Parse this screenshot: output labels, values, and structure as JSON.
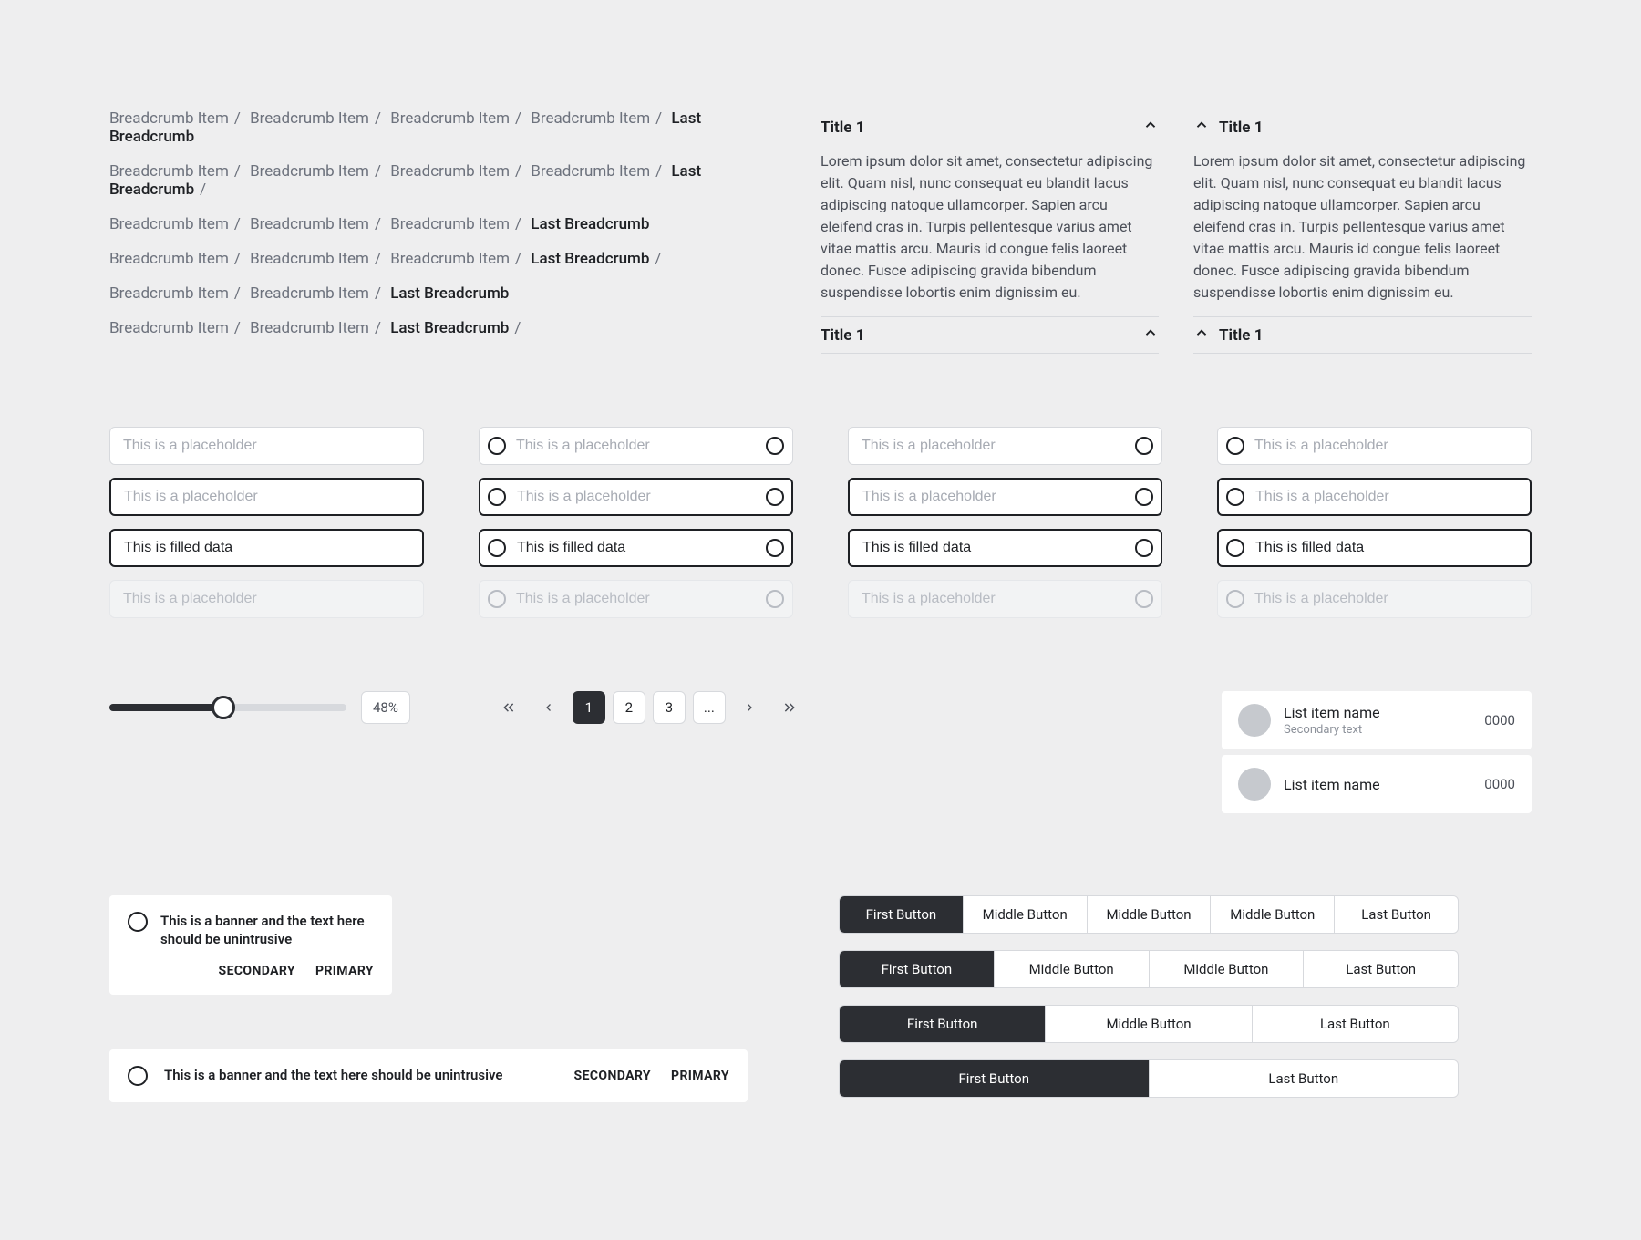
{
  "breadcrumbs": {
    "item": "Breadcrumb Item",
    "last": "Last Breadcrumb",
    "sep": "/"
  },
  "accordion": {
    "title": "Title 1",
    "body": "Lorem ipsum dolor sit amet, consectetur adipiscing elit. Quam nisl, nunc consequat eu blandit lacus adipiscing natoque ullamcorper. Sapien arcu eleifend cras in. Turpis pellentesque varius amet vitae mattis arcu. Mauris id congue felis laoreet donec. Fusce adipiscing gravida bibendum suspendisse lobortis enim dignissim eu."
  },
  "inputs": {
    "placeholder": "This is a placeholder",
    "filled": "This is filled data"
  },
  "slider": {
    "value_label": "48%"
  },
  "pagination": {
    "pages": [
      "1",
      "2",
      "3",
      "..."
    ]
  },
  "list": {
    "name": "List item name",
    "secondary": "Secondary text",
    "number": "0000"
  },
  "banners": {
    "text_multi": "This is a banner and the text here should be unintrusive",
    "text_single": "This is a banner and the text here should be unintrusive",
    "secondary": "SECONDARY",
    "primary": "PRIMARY"
  },
  "button_groups": {
    "first": "First Button",
    "middle": "Middle Button",
    "last": "Last Button"
  }
}
